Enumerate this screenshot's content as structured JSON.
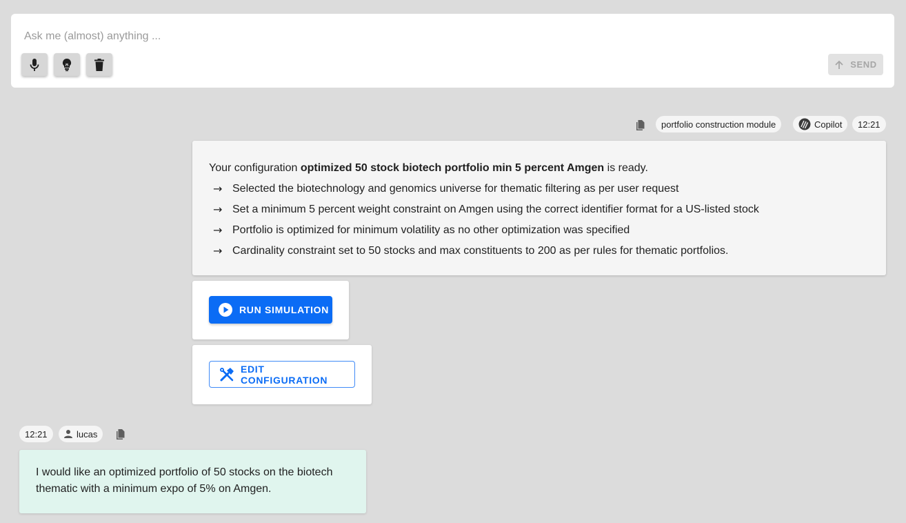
{
  "composer": {
    "placeholder": "Ask me (almost) anything ...",
    "value": "",
    "tools": [
      "microphone-icon",
      "lightbulb-icon",
      "trash-icon"
    ],
    "send_label": "SEND"
  },
  "bot_message": {
    "module_chip": "portfolio construction module",
    "agent_chip": "Copilot",
    "time": "12:21",
    "intro_prefix": "Your configuration ",
    "config_name": "optimized 50 stock biotech portfolio min 5 percent Amgen",
    "intro_suffix": " is ready.",
    "bullet_symbol": "→",
    "bullets": [
      "Selected the biotechnology and genomics universe for thematic filtering as per user request",
      "Set a minimum 5 percent weight constraint on Amgen using the correct identifier format for a US-listed stock",
      "Portfolio is optimized for minimum volatility as no other optimization was specified",
      "Cardinality constraint set to 50 stocks and max constituents to 200 as per rules for thematic portfolios."
    ],
    "run_label": "RUN SIMULATION",
    "edit_label": "EDIT CONFIGURATION"
  },
  "user_message": {
    "time": "12:21",
    "user": "lucas",
    "text": "I would like an optimized portfolio of 50 stocks on the biotech thematic with a minimum expo of 5% on Amgen."
  },
  "colors": {
    "background": "#dcdcdc",
    "accent": "#0b6cf5",
    "user_bubble": "#e0f5ee",
    "bot_bubble": "#f5f5f5"
  }
}
